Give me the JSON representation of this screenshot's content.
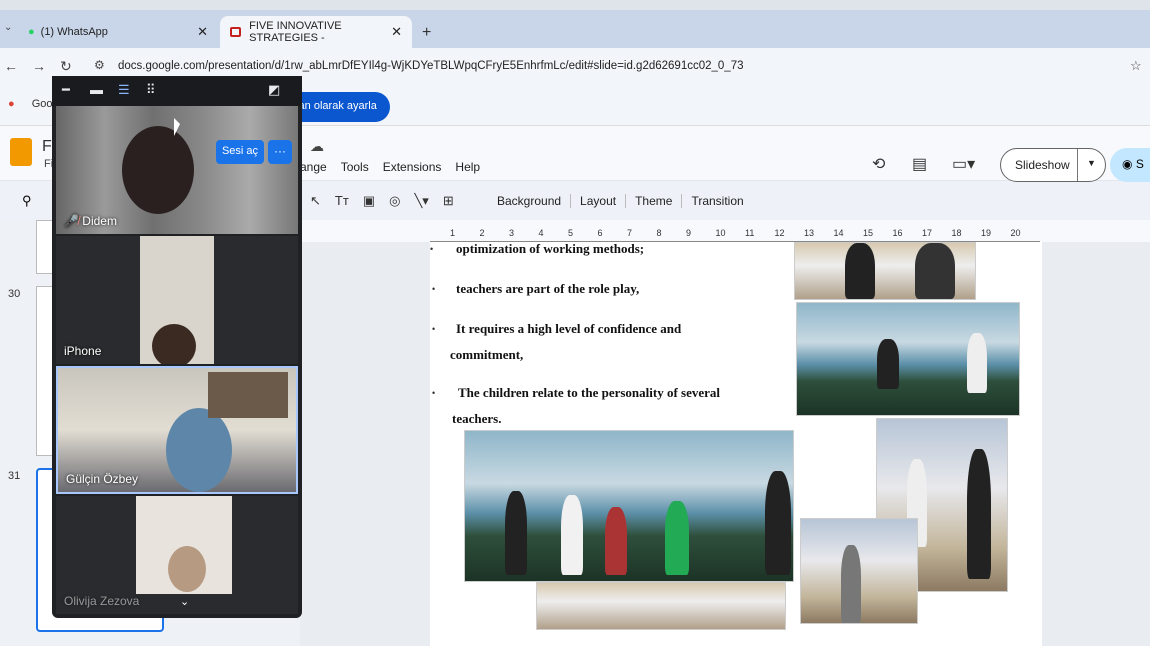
{
  "browser": {
    "tabs": [
      {
        "label": "(1) WhatsApp",
        "icon": "whatsapp-icon"
      },
      {
        "label": "FIVE INNOVATIVE STRATEGIES -",
        "icon": "slides-icon"
      }
    ],
    "url": "docs.google.com/presentation/d/1rw_abLmrDfEYIl4g-WjKDYeTBLWpqCFryE5EnhrfmLc/edit#slide=id.g2d62691cc02_0_73",
    "bookmark_google": "Goo",
    "bookmark_pill": "nlan olarak ayarla"
  },
  "slides_app": {
    "title_fragment": "FI",
    "menu_fragment": "Fi",
    "menus": [
      "rrange",
      "Tools",
      "Extensions",
      "Help"
    ],
    "toolbar_labels": [
      "Background",
      "Layout",
      "Theme",
      "Transition"
    ],
    "slideshow_label": "Slideshow",
    "share_fragment": "S"
  },
  "ruler_numbers": [
    "1",
    "2",
    "3",
    "4",
    "5",
    "6",
    "7",
    "8",
    "9",
    "10",
    "11",
    "12",
    "13",
    "14",
    "15",
    "16",
    "17",
    "18",
    "19",
    "20"
  ],
  "filmstrip": {
    "slide_numbers": [
      "30",
      "31"
    ]
  },
  "slide_content": {
    "bullets": [
      "optimization of working methods;",
      "teachers are part of the role play,",
      "It requires a high level of confidence and",
      "commitment,",
      "The children relate to the personality of several",
      "teachers."
    ]
  },
  "meet": {
    "participants": [
      {
        "name": "Didem",
        "muted": true
      },
      {
        "name": "iPhone",
        "muted": false
      },
      {
        "name": "Gülçin Özbey",
        "muted": false
      },
      {
        "name": "Olivija Zezova",
        "muted": false
      }
    ],
    "unmute_button": "Sesi aç",
    "more_button": "···"
  },
  "colors": {
    "accent_blue": "#1a73e8",
    "meet_bg": "#202124",
    "active_speaker_border": "#a8c7fa",
    "slides_logo": "#f29900"
  }
}
